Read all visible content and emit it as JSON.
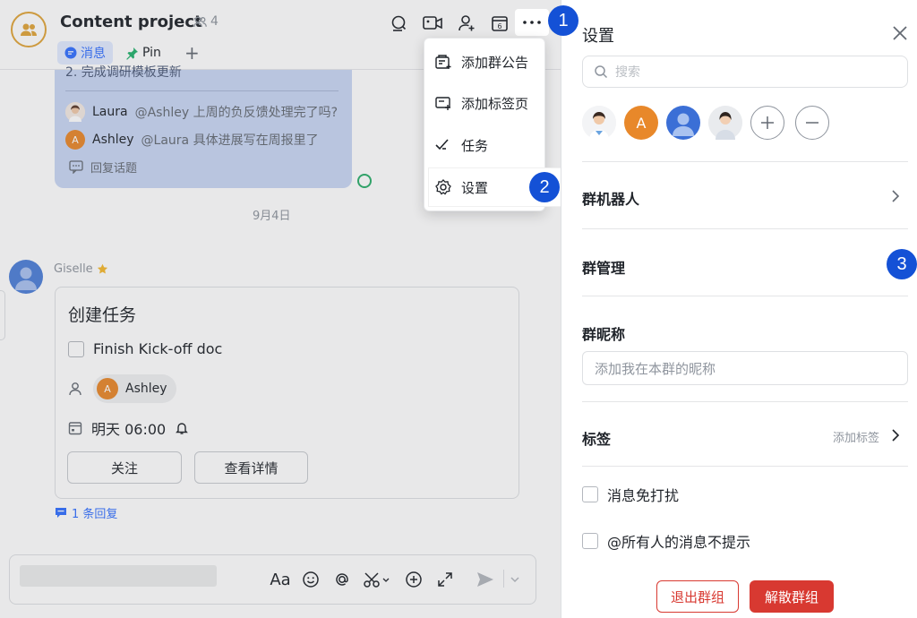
{
  "chat": {
    "title": "Content project",
    "member_count": "4",
    "tabs": [
      {
        "label": "消息"
      },
      {
        "label": "Pin"
      },
      {
        "label": "+"
      }
    ],
    "messages": {
      "partial_line": "2.  完成调研模板更新",
      "replies": [
        {
          "name": "Laura",
          "text": "@Ashley 上周的负反馈处理完了吗?"
        },
        {
          "name": "Ashley",
          "initial": "A",
          "text": "@Laura 具体进展写在周报里了"
        }
      ],
      "reply_topic": "回复话题",
      "date_separator": "9月4日",
      "sender": "Giselle",
      "card": {
        "title": "创建任务",
        "task": "Finish Kick-off doc",
        "assignee": "Ashley",
        "assignee_initial": "A",
        "due": "明天 06:00",
        "btn_follow": "关注",
        "btn_details": "查看详情"
      },
      "reply_count": "1 条回复"
    },
    "composer": {
      "font_tool": "Aa"
    }
  },
  "menu": {
    "items": [
      {
        "label": "添加群公告"
      },
      {
        "label": "添加标签页"
      },
      {
        "label": "任务"
      },
      {
        "label": "设置"
      }
    ]
  },
  "settings": {
    "title": "设置",
    "search_placeholder": "搜索",
    "member_initial": "A",
    "group_bot": "群机器人",
    "group_management": "群管理",
    "group_nickname": "群昵称",
    "nickname_placeholder": "添加我在本群的昵称",
    "tags": "标签",
    "add_tag": "添加标签",
    "mute": "消息免打扰",
    "at_all": "@所有人的消息不提示",
    "leave_group": "退出群组",
    "disband_group": "解散群组"
  },
  "steps": [
    "1",
    "2",
    "3"
  ],
  "colors": {
    "accent": "#3370ff",
    "danger": "#d83931",
    "step": "#1451d6",
    "bubble": "#c9d7f4",
    "avatar_orange": "#e8882a"
  }
}
